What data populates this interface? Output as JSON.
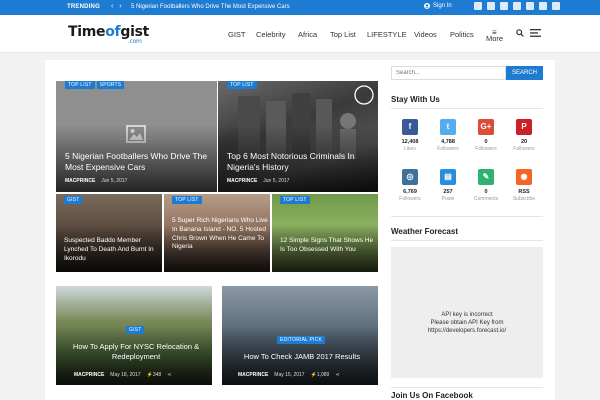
{
  "topbar": {
    "trending_label": "TRENDING",
    "prev": "‹",
    "next": "›",
    "ticker_text": "5 Nigerian Footballers Who Drive The Most Expensive Cars",
    "signin": "Sign In",
    "social_icons": [
      "facebook-icon",
      "twitter-icon",
      "google-plus-icon",
      "youtube-icon",
      "instagram-icon",
      "pinterest-icon",
      "rss-icon"
    ]
  },
  "header": {
    "logo_part1": "Time",
    "logo_part2": "of",
    "logo_part3": "gist",
    "logo_suffix": ".com",
    "nav": [
      "GIST",
      "Celebrity",
      "Africa",
      "Top List",
      "LIFESTYLE",
      "Videos",
      "Politics"
    ],
    "more": "More"
  },
  "featured": [
    {
      "tags": [
        "TOP LIST",
        "SPORTS"
      ],
      "title": "5 Nigerian Footballers Who Drive The Most Expensive Cars",
      "author": "MACPRINCE",
      "date": "Jun 5, 2017"
    },
    {
      "tags": [
        "TOP LIST"
      ],
      "title": "Top 6 Most Notorious Criminals In Nigeria's History",
      "author": "MACPRINCE",
      "date": "Jun 5, 2017"
    }
  ],
  "small_cards": [
    {
      "tag": "GIST",
      "title": "Suspected Baddo Member Lynched To Death And Burnt In Ikorodu"
    },
    {
      "tag": "TOP LIST",
      "title": "5 Super Rich Nigerians Who Live In Banana Island - NO. 5 Hosted Chris Brown When He Came To Nigeria"
    },
    {
      "tag": "TOP LIST",
      "title": "12 Simple Signs That Shows He Is Too Obsessed With You"
    }
  ],
  "bottom_cards": [
    {
      "tag": "GIST",
      "title": "How To Apply For NYSC Relocation & Redeployment",
      "author": "MACPRINCE",
      "date": "May 18, 2017",
      "views": "348"
    },
    {
      "tag": "EDITORIAL PICK",
      "title": "How To Check JAMB 2017 Results",
      "author": "MACPRINCE",
      "date": "May 15, 2017",
      "views": "1,089"
    }
  ],
  "sidebar": {
    "search_placeholder": "Search...",
    "search_button": "SEARCH",
    "stay_heading": "Stay With Us",
    "stats": [
      {
        "icon": "facebook-icon",
        "glyph": "f",
        "color": "#3b5998",
        "num": "12,408",
        "label": "Likes"
      },
      {
        "icon": "twitter-icon",
        "glyph": "t",
        "color": "#55acee",
        "num": "4,788",
        "label": "Followers"
      },
      {
        "icon": "google-plus-icon",
        "glyph": "G+",
        "color": "#dd4b39",
        "num": "0",
        "label": "Followers"
      },
      {
        "icon": "pinterest-icon",
        "glyph": "P",
        "color": "#cb2027",
        "num": "20",
        "label": "Followers"
      },
      {
        "icon": "instagram-icon",
        "glyph": "◎",
        "color": "#3f729b",
        "num": "6,769",
        "label": "Followers"
      },
      {
        "icon": "posts-icon",
        "glyph": "▤",
        "color": "#2a8fd8",
        "num": "257",
        "label": "Posts"
      },
      {
        "icon": "comments-icon",
        "glyph": "✎",
        "color": "#2fb36c",
        "num": "0",
        "label": "Comments"
      },
      {
        "icon": "rss-icon",
        "glyph": "◉",
        "color": "#f26522",
        "num": "RSS",
        "label": "Subscribe"
      }
    ],
    "weather_heading": "Weather Forecast",
    "weather_line1": "API key is incorrect",
    "weather_line2": "Please obtain API Key from",
    "weather_line3": "https://developers.forecast.io/",
    "facebook_heading": "Join Us On Facebook"
  }
}
